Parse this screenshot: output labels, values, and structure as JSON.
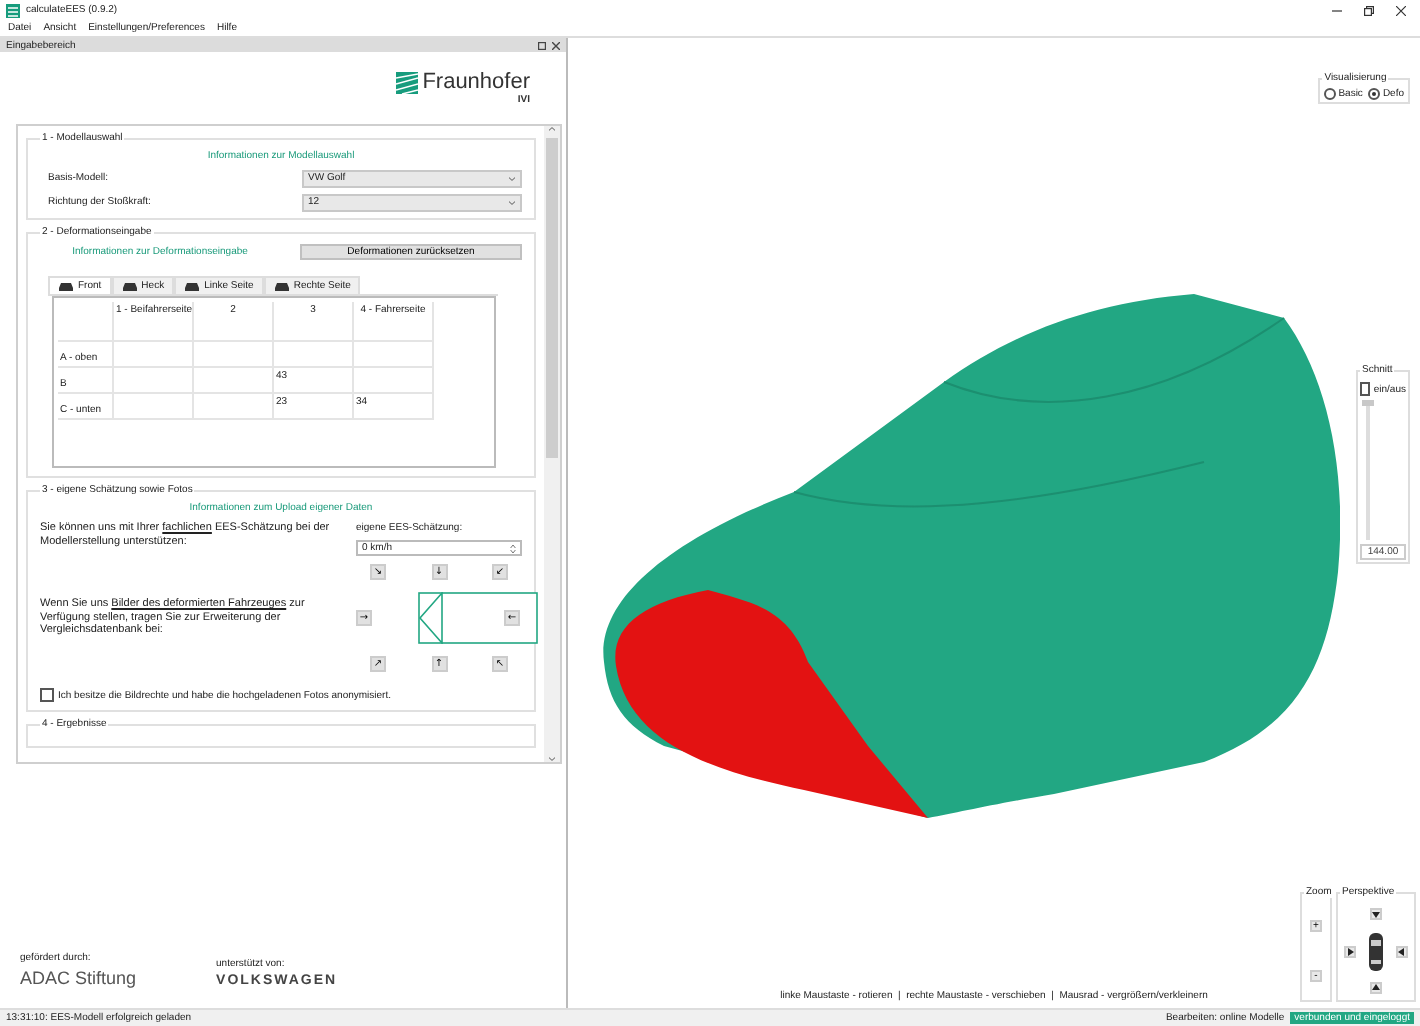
{
  "window": {
    "title": "calculateEES (0.9.2)"
  },
  "menu": [
    "Datei",
    "Ansicht",
    "Einstellungen/Preferences",
    "Hilfe"
  ],
  "dock": {
    "title": "Eingabebereich",
    "logo": {
      "name": "Fraunhofer",
      "sub": "IVI"
    }
  },
  "model_section": {
    "title": "1 - Modellauswahl",
    "info_link": "Informationen zur Modellauswahl",
    "fields": [
      {
        "label": "Basis-Modell:",
        "value": "VW Golf"
      },
      {
        "label": "Richtung der Stoßkraft:",
        "value": "12"
      }
    ]
  },
  "deformation_section": {
    "title": "2 - Deformationseingabe",
    "info_link": "Informationen zur Deformationseingabe",
    "reset_button": "Deformationen zurücksetzen",
    "tabs": [
      {
        "label": "Front",
        "selected": true
      },
      {
        "label": "Heck",
        "selected": false
      },
      {
        "label": "Linke Seite",
        "selected": false
      },
      {
        "label": "Rechte Seite",
        "selected": false
      }
    ],
    "table": {
      "columns": [
        "1 - Beifahrerseite",
        "2",
        "3",
        "4 - Fahrerseite"
      ],
      "rows": [
        {
          "header": "A - oben",
          "cells": [
            null,
            null,
            null,
            null
          ]
        },
        {
          "header": "B",
          "cells": [
            null,
            null,
            "43",
            null
          ]
        },
        {
          "header": "C - unten",
          "cells": [
            null,
            null,
            "23",
            "34"
          ]
        }
      ]
    }
  },
  "estimate_section": {
    "title": "3 - eigene Schätzung sowie Fotos",
    "info_link": "Informationen zum Upload eigener Daten",
    "estimate_text": {
      "before": "Sie können uns mit Ihrer ",
      "link": "fachlichen",
      "after": " EES-Schätzung bei der Modellerstellung unterstützen:"
    },
    "estimate_label": "eigene EES-Schätzung:",
    "estimate_value": "0 km/h",
    "photo_text": {
      "before": "Wenn Sie uns ",
      "link": "Bilder des deformierten Fahrzeuges",
      "after": " zur Verfügung stellen, tragen Sie zur Erweiterung der Vergleichsdatenbank bei:"
    },
    "direction_buttons": {
      "top": [
        "↘",
        "↓",
        "↙"
      ],
      "left": "→",
      "right": "←",
      "bottom": [
        "↗",
        "↑",
        "↖"
      ]
    },
    "rights_checkbox": {
      "label": "Ich besitze die Bildrechte und habe die hochgeladenen Fotos anonymisiert.",
      "checked": false
    }
  },
  "results_section": {
    "title": "4 - Ergebnisse"
  },
  "sponsors": [
    {
      "caption": "gefördert durch:",
      "name": "ADAC Stiftung"
    },
    {
      "caption": "unterstützt von:",
      "name": "VOLKSWAGEN"
    }
  ],
  "visualization": {
    "title": "Visualisierung",
    "options": [
      {
        "label": "Basic",
        "selected": false
      },
      {
        "label": "Defo",
        "selected": true
      }
    ]
  },
  "section_cut": {
    "title": "Schnitt",
    "toggle": {
      "label": "ein/aus",
      "checked": false
    },
    "level": 1,
    "value": "144.00"
  },
  "view_hint": "linke Maustaste - rotieren  |  rechte Maustaste - verschieben  |  Mausrad - vergrößern/verkleinern",
  "zoom": {
    "title": "Zoom",
    "buttons": [
      "+",
      "-"
    ]
  },
  "perspective": {
    "title": "Perspektive"
  },
  "status_bar": {
    "message": "13:31:10: EES-Modell erfolgreich geladen",
    "mode": "Bearbeiten: online Modelle",
    "connection": "verbunden und eingeloggt"
  }
}
